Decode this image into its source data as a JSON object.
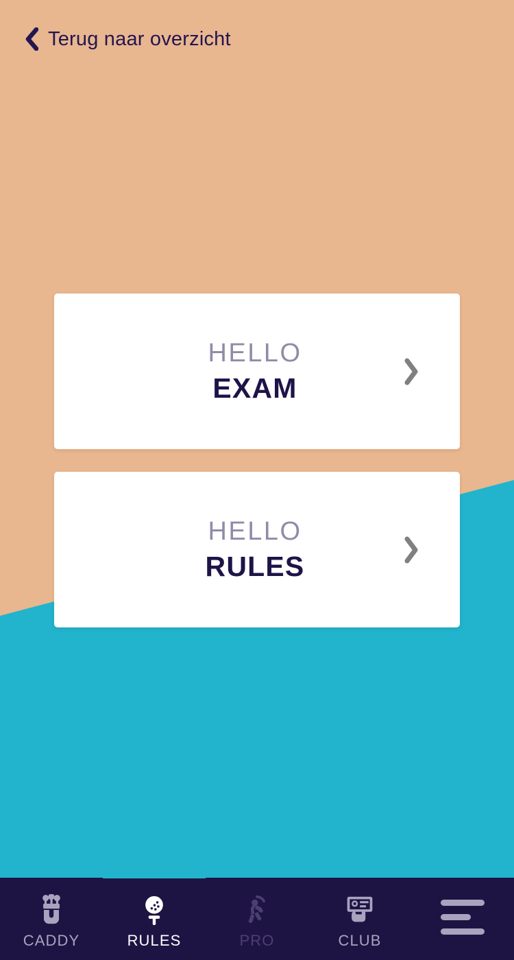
{
  "theme": {
    "background_peach": "#E8B68F",
    "background_teal": "#22B4CC",
    "tabbar_navy": "#1E1444",
    "accent_teal": "#22B4CC",
    "title_navy": "#1E1448",
    "kicker_gray": "#8F8CA8",
    "chevron_gray": "#808080",
    "tab_inactive": "#A8A4BE",
    "tab_active": "#FFFFFF",
    "tab_disabled": "#4A3F70"
  },
  "header": {
    "back_label": "Terug naar overzicht",
    "back_icon": "chevron-left-icon"
  },
  "main": {
    "cards": [
      {
        "kicker": "HELLO",
        "title": "EXAM",
        "chevron_icon": "chevron-right-icon"
      },
      {
        "kicker": "HELLO",
        "title": "RULES",
        "chevron_icon": "chevron-right-icon"
      }
    ]
  },
  "tabbar": {
    "items": [
      {
        "label": "CADDY",
        "icon": "golf-bag-icon",
        "state": "inactive"
      },
      {
        "label": "RULES",
        "icon": "golf-ball-tee-icon",
        "state": "active"
      },
      {
        "label": "PRO",
        "icon": "golfer-swing-icon",
        "state": "disabled"
      },
      {
        "label": "CLUB",
        "icon": "membership-card-icon",
        "state": "inactive"
      }
    ],
    "menu": {
      "icon": "hamburger-menu-icon"
    }
  }
}
